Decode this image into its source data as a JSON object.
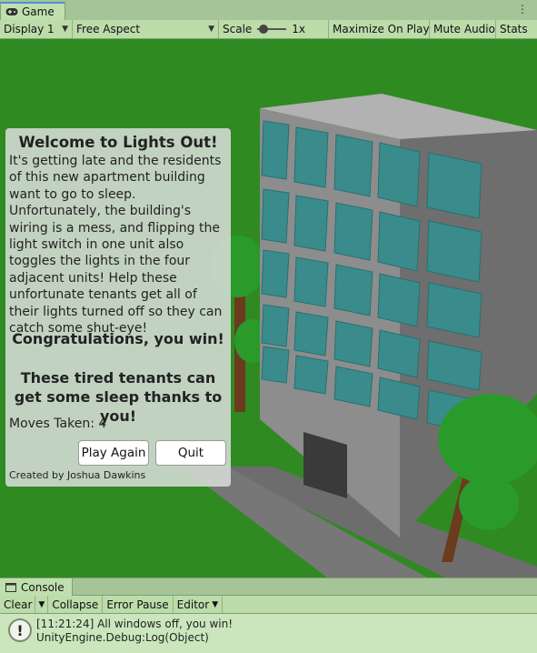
{
  "game_tab": {
    "icon": "gamepad-icon",
    "label": "Game"
  },
  "toolbar": {
    "display": "Display 1",
    "aspect": "Free Aspect",
    "scale_label": "Scale",
    "scale_value": "1x",
    "maximize": "Maximize On Play",
    "mute": "Mute Audio",
    "stats": "Stats"
  },
  "panel": {
    "title": "Welcome to Lights Out!",
    "body": "It's getting late and the residents of this new apartment building want to go to sleep. Unfortunately, the building's wiring is a mess, and flipping the light switch in one unit also toggles the lights in the four adjacent units! Help these unfortunate tenants get all of their lights turned off so they can catch some shut-eye!",
    "congrats": "Congratulations, you win!",
    "tired": "These tired tenants can get some sleep thanks to you!",
    "moves": "Moves Taken: 4",
    "play_again": "Play Again",
    "quit": "Quit",
    "credit": "Created by Joshua Dawkins"
  },
  "console": {
    "tab_label": "Console",
    "tab_icon": "console-icon",
    "clear": "Clear",
    "collapse": "Collapse",
    "error_pause": "Error Pause",
    "editor": "Editor",
    "log_line1": "[11:21:24] All windows off, you win!",
    "log_line2": "UnityEngine.Debug:Log(Object)",
    "log_icon": "info-icon"
  },
  "colors": {
    "ground": "#2f8a22",
    "building": "#8c8c8c",
    "window": "#3a8c8c",
    "tree_canopy": "#2a9a2a",
    "editor_bg": "#bcdcaa"
  }
}
